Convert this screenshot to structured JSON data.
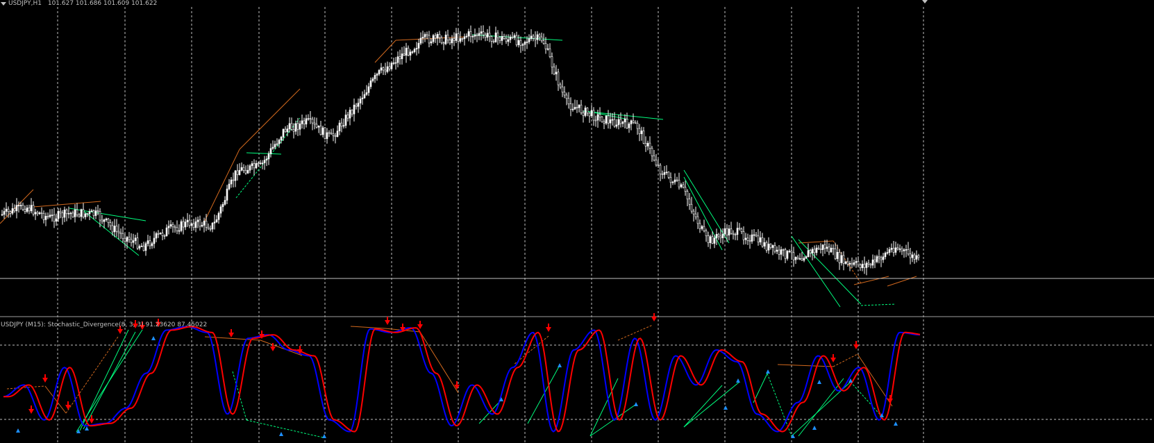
{
  "main_chart": {
    "symbol": "USDJPY,H1",
    "ohlc": "101.627 101.686 101.609 101.622"
  },
  "indicator": {
    "label": "USDJPY (M15):  Stochastic_Divergence(8, 3, 3) 91.23620 87.45022"
  },
  "colors": {
    "background": "#000000",
    "grid": "#c0c0c0",
    "candle": "#ffffff",
    "bearish_divergence": "#d2691e",
    "bullish_divergence": "#00ff7f",
    "stoch_main": "#0000ff",
    "stoch_signal": "#ff0000",
    "arrow_down": "#ff0000",
    "arrow_up": "#1e90ff",
    "price_line": "#c0c0c0"
  },
  "chart_data": {
    "type": "candlestick+stochastic",
    "note_price_path": [
      101.92,
      101.97,
      101.9,
      101.93,
      101.92,
      101.8,
      101.72,
      101.82,
      101.87,
      101.85,
      102.2,
      102.22,
      102.45,
      102.5,
      102.4,
      102.6,
      102.8,
      102.92,
      103.02,
      103.02,
      103.05,
      103.03,
      103.01,
      103.02,
      102.62,
      102.55,
      102.5,
      102.48,
      102.2,
      102.07,
      101.75,
      101.82,
      101.77,
      101.68,
      101.66,
      101.72,
      101.6,
      101.61,
      101.72,
      101.63
    ],
    "stochastic_path": [
      35,
      45,
      15,
      60,
      10,
      12,
      25,
      55,
      92,
      95,
      90,
      20,
      85,
      88,
      75,
      70,
      15,
      5,
      93,
      90,
      94,
      55,
      10,
      45,
      20,
      60,
      90,
      5,
      75,
      92,
      15,
      85,
      15,
      70,
      45,
      75,
      65,
      20,
      5,
      30,
      70,
      40,
      60,
      15,
      90,
      88
    ],
    "levels": [
      80,
      20
    ]
  }
}
